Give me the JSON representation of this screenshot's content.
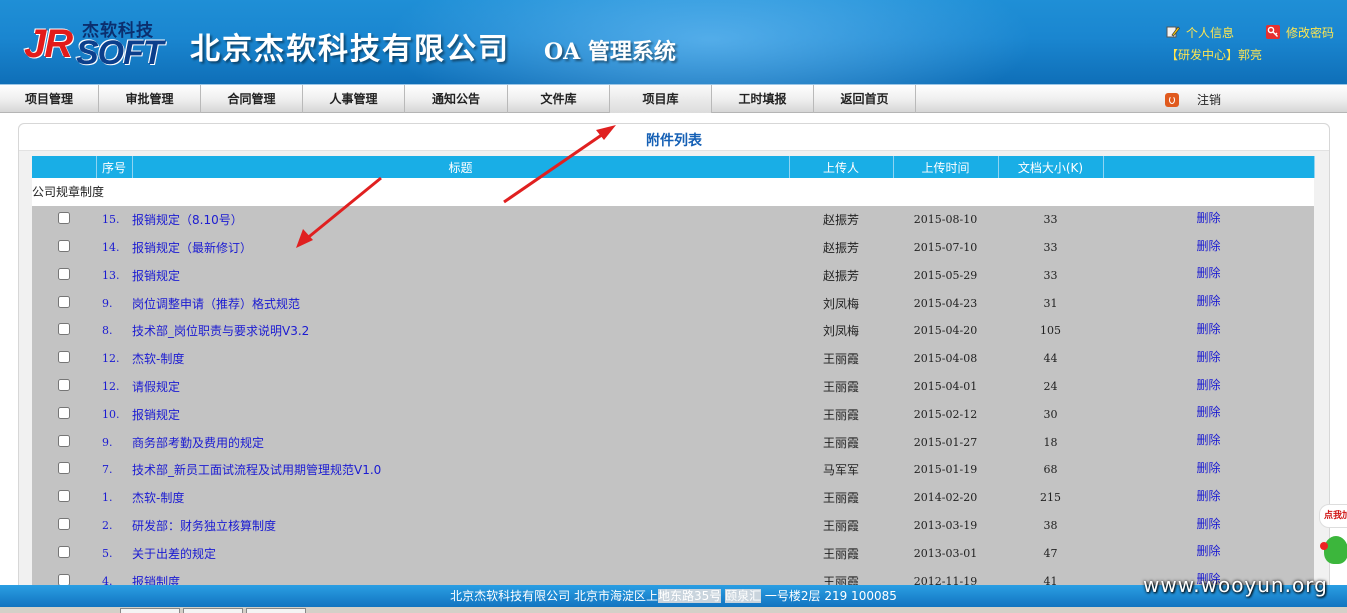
{
  "header": {
    "logo_jr": "JR",
    "logo_soft": "SOFT",
    "logo_cn": "杰软科技",
    "company": "北京杰软科技有限公司",
    "system": "OA 管理系统",
    "profile_link": "个人信息",
    "password_link": "修改密码",
    "user": "【研发中心】郭亮",
    "profile_icon": "pen-icon",
    "password_icon": "key-icon"
  },
  "nav": {
    "tabs": [
      "项目管理",
      "审批管理",
      "合同管理",
      "人事管理",
      "通知公告",
      "文件库",
      "项目库",
      "工时填报",
      "返回首页"
    ],
    "active_tab": "项目库",
    "logout": "注销",
    "logout_icon": "power-icon"
  },
  "panel": {
    "title": "附件列表"
  },
  "table": {
    "headers": {
      "no": "序号",
      "title": "标题",
      "uploader": "上传人",
      "upload_time": "上传时间",
      "size": "文档大小(K)"
    },
    "group": "公司规章制度",
    "delete_label": "删除",
    "rows": [
      {
        "no": "15.",
        "title": "报销规定（8.10号）",
        "uploader": "赵振芳",
        "time": "2015-08-10",
        "size": "33"
      },
      {
        "no": "14.",
        "title": "报销规定（最新修订）",
        "uploader": "赵振芳",
        "time": "2015-07-10",
        "size": "33"
      },
      {
        "no": "13.",
        "title": "报销规定",
        "uploader": "赵振芳",
        "time": "2015-05-29",
        "size": "33"
      },
      {
        "no": "9.",
        "title": "岗位调整申请（推荐）格式规范",
        "uploader": "刘凤梅",
        "time": "2015-04-23",
        "size": "31"
      },
      {
        "no": "8.",
        "title": "技术部_岗位职责与要求说明V3.2",
        "uploader": "刘凤梅",
        "time": "2015-04-20",
        "size": "105"
      },
      {
        "no": "12.",
        "title": "杰软-制度",
        "uploader": "王丽霞",
        "time": "2015-04-08",
        "size": "44"
      },
      {
        "no": "12.",
        "title": "请假规定",
        "uploader": "王丽霞",
        "time": "2015-04-01",
        "size": "24"
      },
      {
        "no": "10.",
        "title": "报销规定",
        "uploader": "王丽霞",
        "time": "2015-02-12",
        "size": "30"
      },
      {
        "no": "9.",
        "title": "商务部考勤及费用的规定",
        "uploader": "王丽霞",
        "time": "2015-01-27",
        "size": "18"
      },
      {
        "no": "7.",
        "title": "技术部_新员工面试流程及试用期管理规范V1.0",
        "uploader": "马军军",
        "time": "2015-01-19",
        "size": "68"
      },
      {
        "no": "1.",
        "title": "杰软-制度",
        "uploader": "王丽霞",
        "time": "2014-02-20",
        "size": "215"
      },
      {
        "no": "2.",
        "title": "研发部：财务独立核算制度",
        "uploader": "王丽霞",
        "time": "2013-03-19",
        "size": "38"
      },
      {
        "no": "5.",
        "title": "关于出差的规定",
        "uploader": "王丽霞",
        "time": "2013-03-01",
        "size": "47"
      },
      {
        "no": "4.",
        "title": "报销制度",
        "uploader": "王丽霞",
        "time": "2012-11-19",
        "size": "41"
      }
    ]
  },
  "footer": {
    "pre": "北京杰软科技有限公司 北京市海淀区上",
    "hl1": "地东路35号",
    "mid": " ",
    "hl2": "颐泉汇",
    "post": " 一号楼2层 219 100085"
  },
  "watermark": "www.wooyun.org",
  "side_widget": "点我加",
  "colors": {
    "header_blue": "#1a86d0",
    "table_header": "#19aee6",
    "row_bg": "#c3c3c3",
    "link_blue": "#1b1bd2",
    "title_blue": "#1560b5",
    "accent_yellow": "#ffe650",
    "annotation_red": "#e02020"
  }
}
